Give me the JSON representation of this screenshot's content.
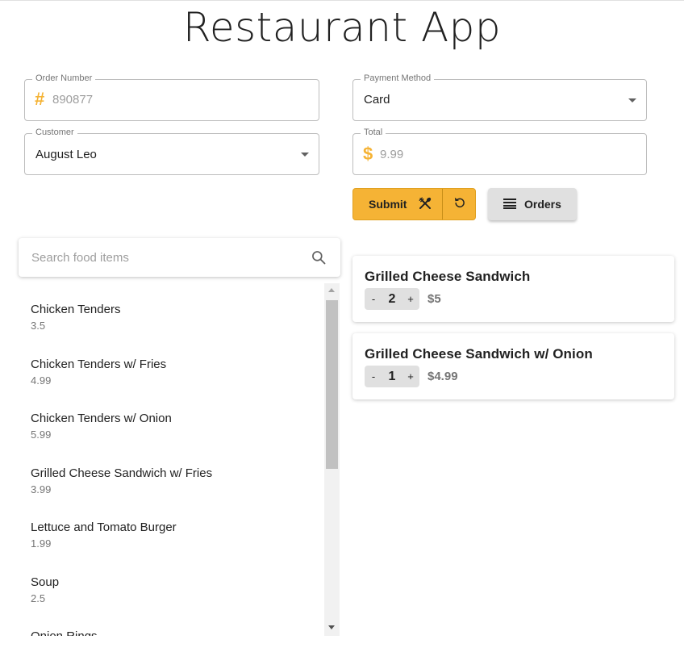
{
  "app": {
    "title": "Restaurant App"
  },
  "form": {
    "order_number": {
      "label": "Order Number",
      "symbol": "#",
      "value": "890877"
    },
    "payment_method": {
      "label": "Payment Method",
      "value": "Card"
    },
    "customer": {
      "label": "Customer",
      "value": "August Leo"
    },
    "total": {
      "label": "Total",
      "symbol": "$",
      "value": "9.99"
    }
  },
  "actions": {
    "submit_label": "Submit",
    "orders_label": "Orders"
  },
  "search": {
    "placeholder": "Search food items"
  },
  "food_items": [
    {
      "name": "Chicken Tenders",
      "price": "3.5"
    },
    {
      "name": "Chicken Tenders w/ Fries",
      "price": "4.99"
    },
    {
      "name": "Chicken Tenders w/ Onion",
      "price": "5.99"
    },
    {
      "name": "Grilled Cheese Sandwich w/ Fries",
      "price": "3.99"
    },
    {
      "name": "Lettuce and Tomato Burger",
      "price": "1.99"
    },
    {
      "name": "Soup",
      "price": "2.5"
    },
    {
      "name": "Onion Rings",
      "price": ""
    }
  ],
  "order_items": [
    {
      "name": "Grilled Cheese Sandwich",
      "minus": "-",
      "quantity": "2",
      "plus": "+",
      "price": "$5"
    },
    {
      "name": "Grilled Cheese Sandwich w/ Onion",
      "minus": "-",
      "quantity": "1",
      "plus": "+",
      "price": "$4.99"
    }
  ],
  "colors": {
    "accent": "#f5b335",
    "button_grey": "#e0e0e0"
  }
}
